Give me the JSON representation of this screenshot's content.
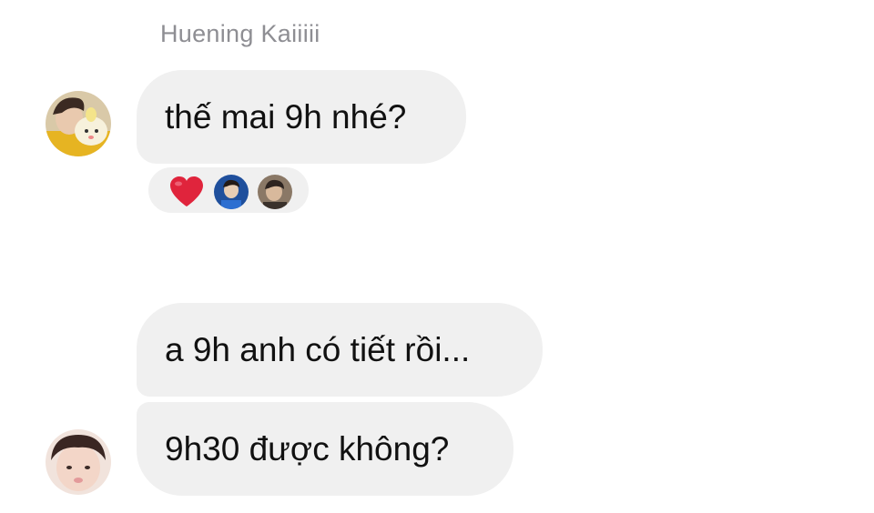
{
  "thread": {
    "sender_name": "Huening Kaiiiii",
    "messages": [
      {
        "from": "Huening Kaiiiii",
        "text": "thế mai 9h nhé?"
      },
      {
        "from": "other",
        "text": "a 9h anh có tiết rồi..."
      },
      {
        "from": "other",
        "text": "9h30 được không?"
      }
    ],
    "reactions": [
      {
        "icon": "red-heart-icon"
      },
      {
        "icon": "reactor-avatar"
      },
      {
        "icon": "reactor-avatar"
      }
    ]
  },
  "colors": {
    "bubble_background": "#f0f0f0",
    "bubble_text": "#111111",
    "sender_name": "#8e8e93",
    "heart": "#e0243c"
  }
}
